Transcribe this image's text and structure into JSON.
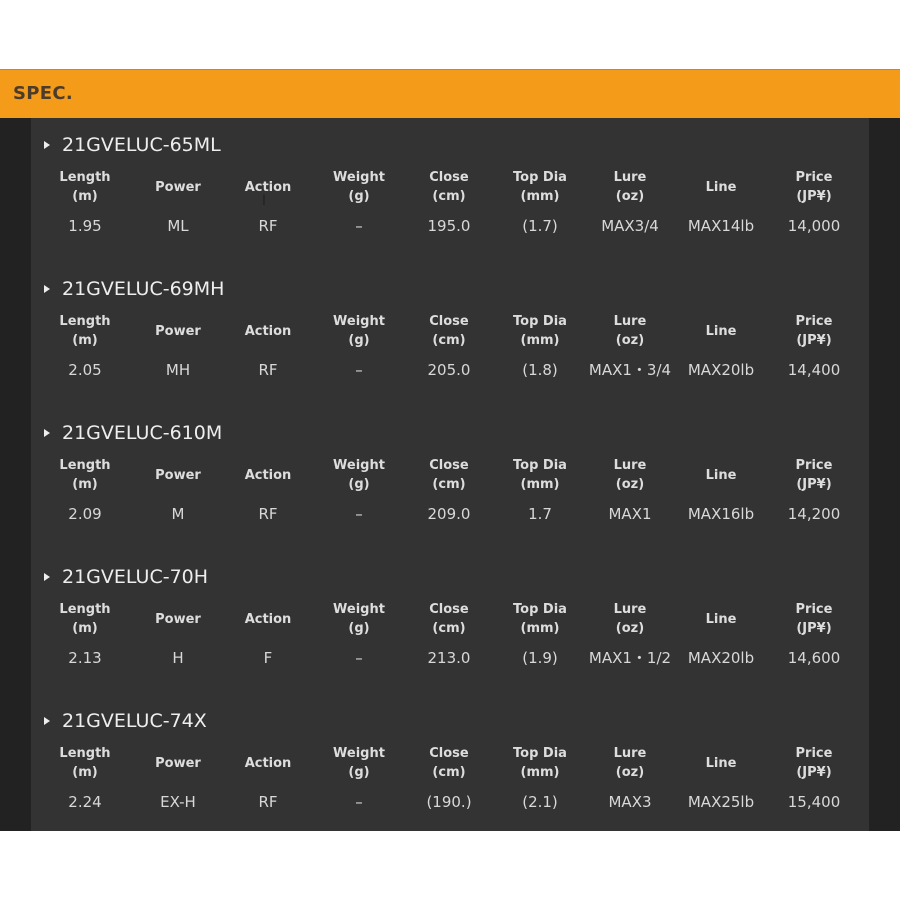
{
  "section": {
    "title": "SPEC."
  },
  "columns": [
    {
      "line1": "Length",
      "line2": "(m)"
    },
    {
      "line1": "Power",
      "line2": ""
    },
    {
      "line1": "Action",
      "line2": ""
    },
    {
      "line1": "Weight",
      "line2": "(g)"
    },
    {
      "line1": "Close",
      "line2": "(cm)"
    },
    {
      "line1": "Top Dia",
      "line2": "(mm)"
    },
    {
      "line1": "Lure",
      "line2": "(oz)"
    },
    {
      "line1": "Line",
      "line2": ""
    },
    {
      "line1": "Price",
      "line2": "(JP¥)"
    }
  ],
  "models": [
    {
      "name": "21GVELUC-65ML",
      "values": [
        "1.95",
        "ML",
        "RF",
        "–",
        "195.0",
        "(1.7)",
        "MAX3/4",
        "MAX14lb",
        "14,000"
      ]
    },
    {
      "name": "21GVELUC-69MH",
      "values": [
        "2.05",
        "MH",
        "RF",
        "–",
        "205.0",
        "(1.8)",
        "MAX1・3/4",
        "MAX20lb",
        "14,400"
      ]
    },
    {
      "name": "21GVELUC-610M",
      "values": [
        "2.09",
        "M",
        "RF",
        "–",
        "209.0",
        "1.7",
        "MAX1",
        "MAX16lb",
        "14,200"
      ]
    },
    {
      "name": "21GVELUC-70H",
      "values": [
        "2.13",
        "H",
        "F",
        "–",
        "213.0",
        "(1.9)",
        "MAX1・1/2",
        "MAX20lb",
        "14,600"
      ]
    },
    {
      "name": "21GVELUC-74X",
      "values": [
        "2.24",
        "EX-H",
        "RF",
        "–",
        "(190.)",
        "(2.1)",
        "MAX3",
        "MAX25lb",
        "15,400"
      ]
    }
  ]
}
